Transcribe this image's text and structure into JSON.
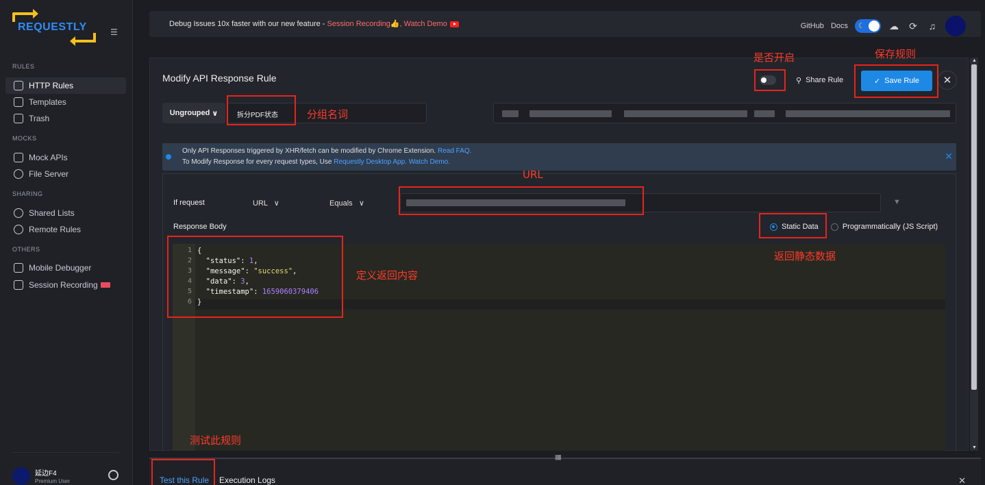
{
  "app": {
    "logo_text": "REQUESTLY"
  },
  "sidebar": {
    "sections": [
      {
        "title": "RULES",
        "items": [
          {
            "label": "HTTP Rules",
            "icon": "http-rules-icon",
            "active": true
          },
          {
            "label": "Templates",
            "icon": "templates-icon"
          },
          {
            "label": "Trash",
            "icon": "trash-icon"
          }
        ]
      },
      {
        "title": "MOCKS",
        "items": [
          {
            "label": "Mock APIs",
            "icon": "mock-apis-icon"
          },
          {
            "label": "File Server",
            "icon": "file-server-icon"
          }
        ]
      },
      {
        "title": "SHARING",
        "items": [
          {
            "label": "Shared Lists",
            "icon": "shared-lists-icon"
          },
          {
            "label": "Remote Rules",
            "icon": "remote-rules-icon"
          }
        ]
      },
      {
        "title": "OTHERS",
        "items": [
          {
            "label": "Mobile Debugger",
            "icon": "mobile-icon"
          },
          {
            "label": "Session Recording",
            "icon": "session-icon"
          }
        ]
      }
    ],
    "user": {
      "name": "延边F4",
      "role": "Premium User"
    }
  },
  "topbar": {
    "banner_prefix": "Debug Issues 10x faster with our new feature - ",
    "banner_feature": "Session Recording",
    "banner_sep": "👍, ",
    "banner_link": "Watch Demo",
    "github": "GitHub",
    "docs": "Docs"
  },
  "editor_page": {
    "title": "Modify API Response Rule",
    "share_label": "Share Rule",
    "save_label": "Save Rule",
    "group_label": "Ungrouped",
    "rule_name": "拆分PDF状态",
    "info_line1_text": "Only API Responses triggered by XHR/fetch can be modified by Chrome Extension. ",
    "info_line1_link": "Read FAQ.",
    "info_line2_text": "To Modify Response for every request types, Use ",
    "info_line2_link1": "Requestly Desktop App.",
    "info_line2_link2": "Watch Demo.",
    "if_request": "If request",
    "url_option": "URL",
    "operator": "Equals",
    "response_body_label": "Response Body",
    "static_data": "Static Data",
    "programmatic": "Programmatically (JS Script)"
  },
  "code": {
    "lines": [
      "1",
      "2",
      "3",
      "4",
      "5",
      "6"
    ],
    "status_key": "\"status\"",
    "status_val": "1",
    "message_key": "\"message\"",
    "message_val": "\"success\"",
    "data_key": "\"data\"",
    "data_val": "3",
    "timestamp_key": "\"timestamp\"",
    "timestamp_val": "1659060379406"
  },
  "annotations": {
    "enable": "是否开启",
    "save": "保存规则",
    "group": "分组名词",
    "url": "URL",
    "static": "返回静态数据",
    "content": "定义返回内容",
    "test": "测试此规则"
  },
  "bottom": {
    "tab_test": "Test this Rule",
    "tab_logs": "Execution Logs"
  },
  "colors": {
    "accent": "#1e88e5",
    "annotation": "#e8241c",
    "logo_yellow": "#f7c01b"
  }
}
